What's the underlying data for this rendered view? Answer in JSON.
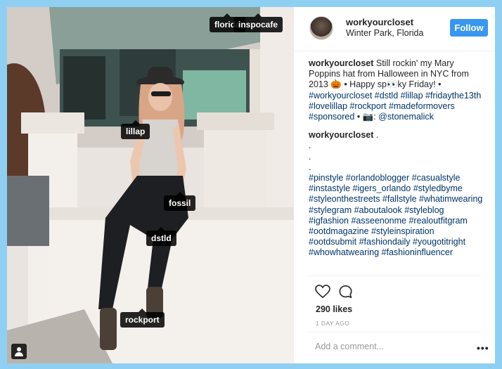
{
  "post": {
    "username": "workyourcloset",
    "location": "Winter Park, Florida",
    "follow_label": "Follow"
  },
  "tags": {
    "florida": "florida",
    "inspocafe": "inspocafe",
    "lillap": "lillap",
    "fossil": "fossil",
    "dstld": "dstld",
    "rockport": "rockport"
  },
  "caption": {
    "username": "workyourcloset",
    "text": "Still rockin' my Mary Poppins hat from Halloween in NYC from 2013 🎃 • Happy sp👀ky Friday! •",
    "hashtags": "#workyourcloset #dstld #lillap #fridaythe13th #lovelillap #rockport #madeformovers #sponsored",
    "tail": " • 📷:",
    "mention": "@stonemalick"
  },
  "comment2": {
    "username": "workyourcloset",
    "text": ".",
    "dots": [
      ".",
      ".",
      "."
    ],
    "hashtags": "#pinstyle #orlandoblogger #casualstyle #instastyle #igers_orlando #styledbyme #styleonthestreets #fallstyle #whatimwearing #stylegram #aboutalook #styleblog #igfashion #asseenonme #realoutfitgram #ootdmagazine #styleinspiration #ootdsubmit #fashiondaily #yougotitright #whowhatwearing #fashioninfluencer"
  },
  "stats": {
    "likes": "290 likes",
    "time_ago": "1 DAY AGO"
  },
  "input": {
    "placeholder": "Add a comment..."
  },
  "more_label": "•••",
  "colors": {
    "background": "#8fd0f2",
    "follow_button": "#3897f0",
    "link": "#003569"
  },
  "icons": [
    "heart-icon",
    "comment-icon",
    "user-tag-icon"
  ]
}
